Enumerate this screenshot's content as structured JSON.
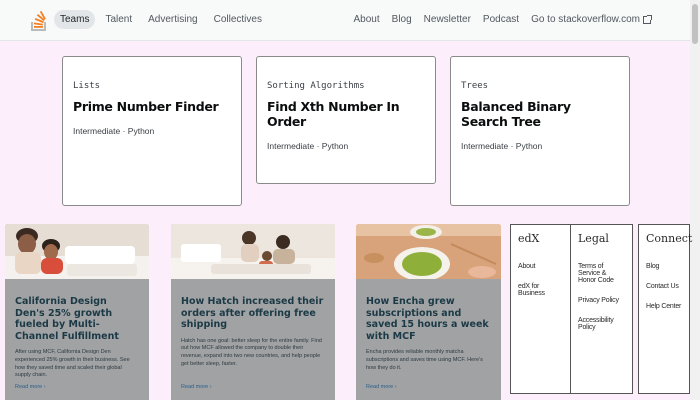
{
  "nav": {
    "left": [
      "Teams",
      "Talent",
      "Advertising",
      "Collectives"
    ],
    "right": [
      "About",
      "Blog",
      "Newsletter",
      "Podcast",
      "Go to stackoverflow.com"
    ]
  },
  "cards": [
    {
      "category": "Lists",
      "title": "Prime Number Finder",
      "meta": "Intermediate · Python"
    },
    {
      "category": "Sorting Algorithms",
      "title": "Find Xth Number In Order",
      "meta": "Intermediate · Python"
    },
    {
      "category": "Trees",
      "title": "Balanced Binary Search Tree",
      "meta": "Intermediate · Python"
    }
  ],
  "stories": [
    {
      "title": "California Design Den's 25% growth fueled by Multi-Channel Fulfillment",
      "desc": "After using MCF, California Design Den experienced 25% growth in their business. See how they saved time and scaled their global supply chain.",
      "more": "Read more ›"
    },
    {
      "title": "How Hatch increased their orders after offering free shipping",
      "desc": "Hatch has one goal: better sleep for the entire family. Find out how MCF allowed the company to double their revenue, expand into two new countries, and help people get better sleep, faster.",
      "more": "Read more ›"
    },
    {
      "title": "How Encha grew subscriptions and saved 15 hours a week with MCF",
      "desc": "Encha provides reliable monthly matcha subscriptions and saves time using MCF. Here's how they do it.",
      "more": "Read more ›"
    }
  ],
  "footer": [
    {
      "heading": "edX",
      "links": [
        "About",
        "edX for Business"
      ]
    },
    {
      "heading": "Legal",
      "links": [
        "Terms of Service & Honor Code",
        "Privacy Policy",
        "Accessibility Policy"
      ]
    },
    {
      "heading": "Connect",
      "links": [
        "Blog",
        "Contact Us",
        "Help Center"
      ]
    }
  ]
}
